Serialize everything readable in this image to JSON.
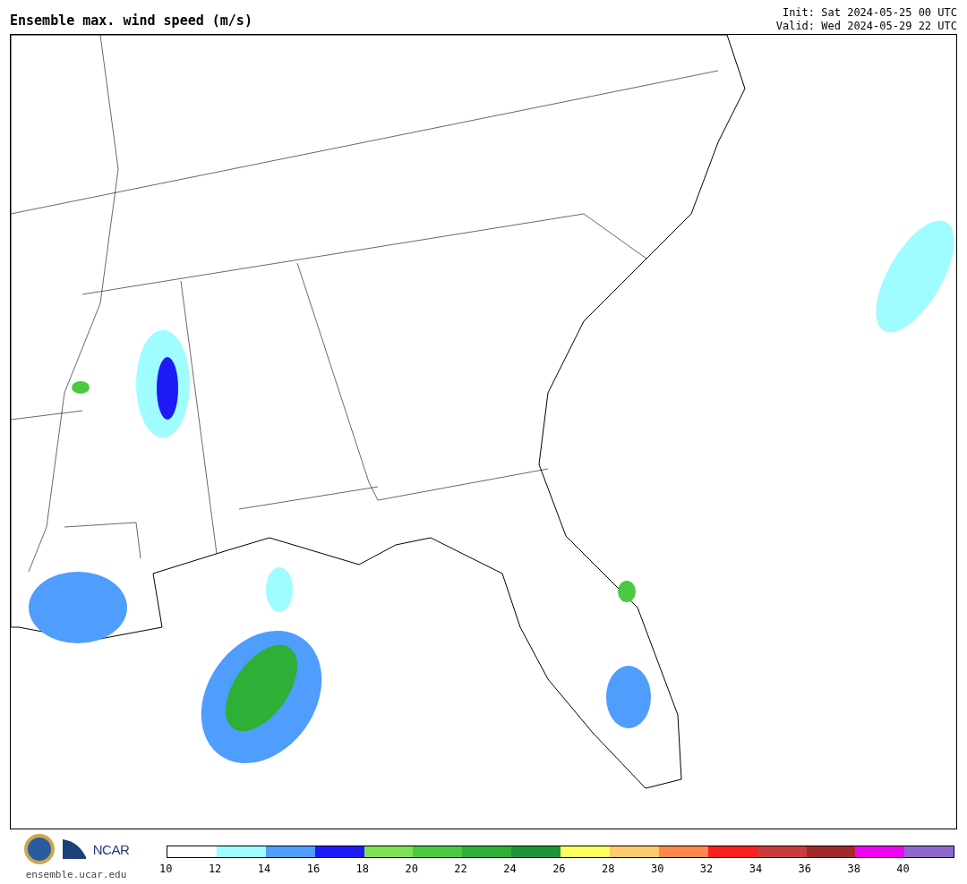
{
  "title": "Ensemble max. wind speed (m/s)",
  "init": "Init: Sat 2024-05-25 00 UTC",
  "valid": "Valid: Wed 2024-05-29 22 UTC",
  "logo_text": "NCAR",
  "site": "ensemble.ucar.edu",
  "legend": [
    {
      "label": "10",
      "color": "#ffffff"
    },
    {
      "label": "12",
      "color": "#9ffcff"
    },
    {
      "label": "14",
      "color": "#4f9dfd"
    },
    {
      "label": "16",
      "color": "#1d1af7"
    },
    {
      "label": "18",
      "color": "#7ee154"
    },
    {
      "label": "20",
      "color": "#4ac941"
    },
    {
      "label": "22",
      "color": "#2eaf35"
    },
    {
      "label": "24",
      "color": "#1f933a"
    },
    {
      "label": "26",
      "color": "#fdfd5f"
    },
    {
      "label": "28",
      "color": "#fdcb6c"
    },
    {
      "label": "30",
      "color": "#fd874d"
    },
    {
      "label": "32",
      "color": "#fb1f20"
    },
    {
      "label": "34",
      "color": "#c73d3d"
    },
    {
      "label": "36",
      "color": "#a1292a"
    },
    {
      "label": "38",
      "color": "#ec04ec"
    },
    {
      "label": "40",
      "color": "#8e67cd"
    }
  ]
}
